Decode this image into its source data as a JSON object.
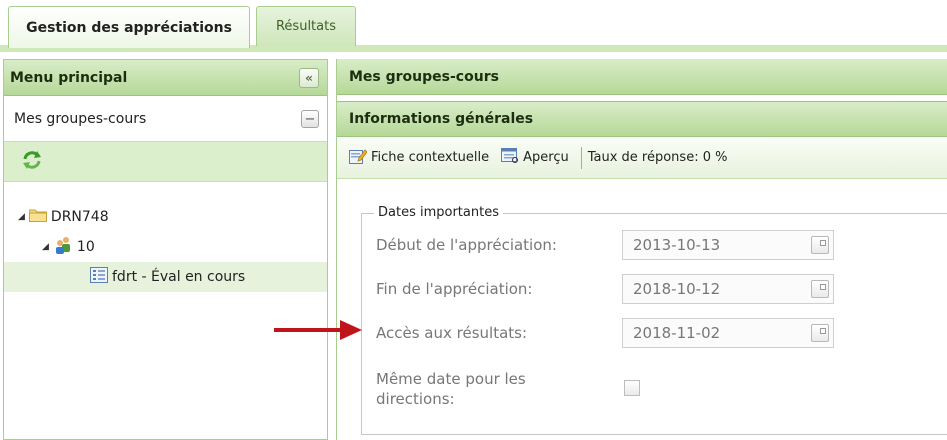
{
  "tabs": [
    {
      "label": "Gestion des appréciations",
      "active": true
    },
    {
      "label": "Résultats",
      "active": false
    }
  ],
  "left_panel": {
    "title": "Menu principal",
    "collapse_icon": "double-chevron-left-icon",
    "subsection": "Mes groupes-cours",
    "tree": [
      {
        "label": "DRN748",
        "icon": "folder-icon",
        "level": 1,
        "expanded": true
      },
      {
        "label": "10",
        "icon": "group-users-icon",
        "level": 2,
        "expanded": true
      },
      {
        "label": "fdrt - Éval en cours",
        "icon": "form-icon",
        "level": 3,
        "selected": true
      }
    ]
  },
  "right_panel": {
    "title": "Mes groupes-cours",
    "section_title": "Informations générales",
    "toolbar": {
      "fiche_label": "Fiche contextuelle",
      "apercu_label": "Aperçu",
      "taux_label": "Taux de réponse: 0 %"
    },
    "dates": {
      "legend": "Dates importantes",
      "debut_label": "Début de l'appréciation:",
      "debut_value": "2013-10-13",
      "fin_label": "Fin de l'appréciation:",
      "fin_value": "2018-10-12",
      "acces_label": "Accès aux résultats:",
      "acces_value": "2018-11-02",
      "meme_label_line1": "Même date pour les",
      "meme_label_line2": "directions:",
      "meme_checked": false
    }
  },
  "colors": {
    "header_green": "#b5d898",
    "tab_border": "#a9cd8e",
    "arrow_red": "#c0141b"
  }
}
